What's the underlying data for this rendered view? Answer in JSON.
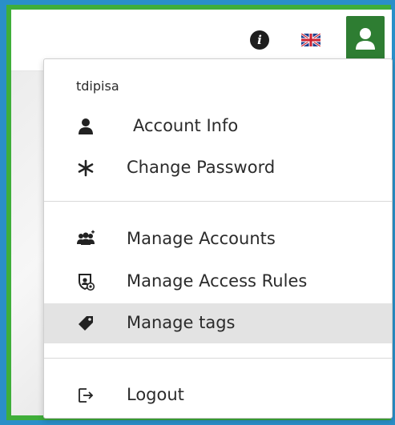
{
  "header": {
    "info_icon": "info-circle-icon",
    "language_icon": "uk-flag-icon",
    "user_icon": "user-icon",
    "colors": {
      "user_button_bg": "#2e7d32",
      "frame_green": "#3fae3a",
      "frame_blue": "#2a8fc8"
    }
  },
  "user_menu": {
    "username": "tdipisa",
    "items": [
      {
        "label": "Account Info",
        "icon": "user-icon"
      },
      {
        "label": "Change Password",
        "icon": "asterisk-icon"
      },
      {
        "label": "Manage Accounts",
        "icon": "users-group-icon"
      },
      {
        "label": "Manage Access Rules",
        "icon": "access-rules-icon"
      },
      {
        "label": "Manage tags",
        "icon": "tag-icon"
      },
      {
        "label": "Logout",
        "icon": "logout-icon"
      }
    ],
    "highlighted_item": "Manage tags"
  }
}
